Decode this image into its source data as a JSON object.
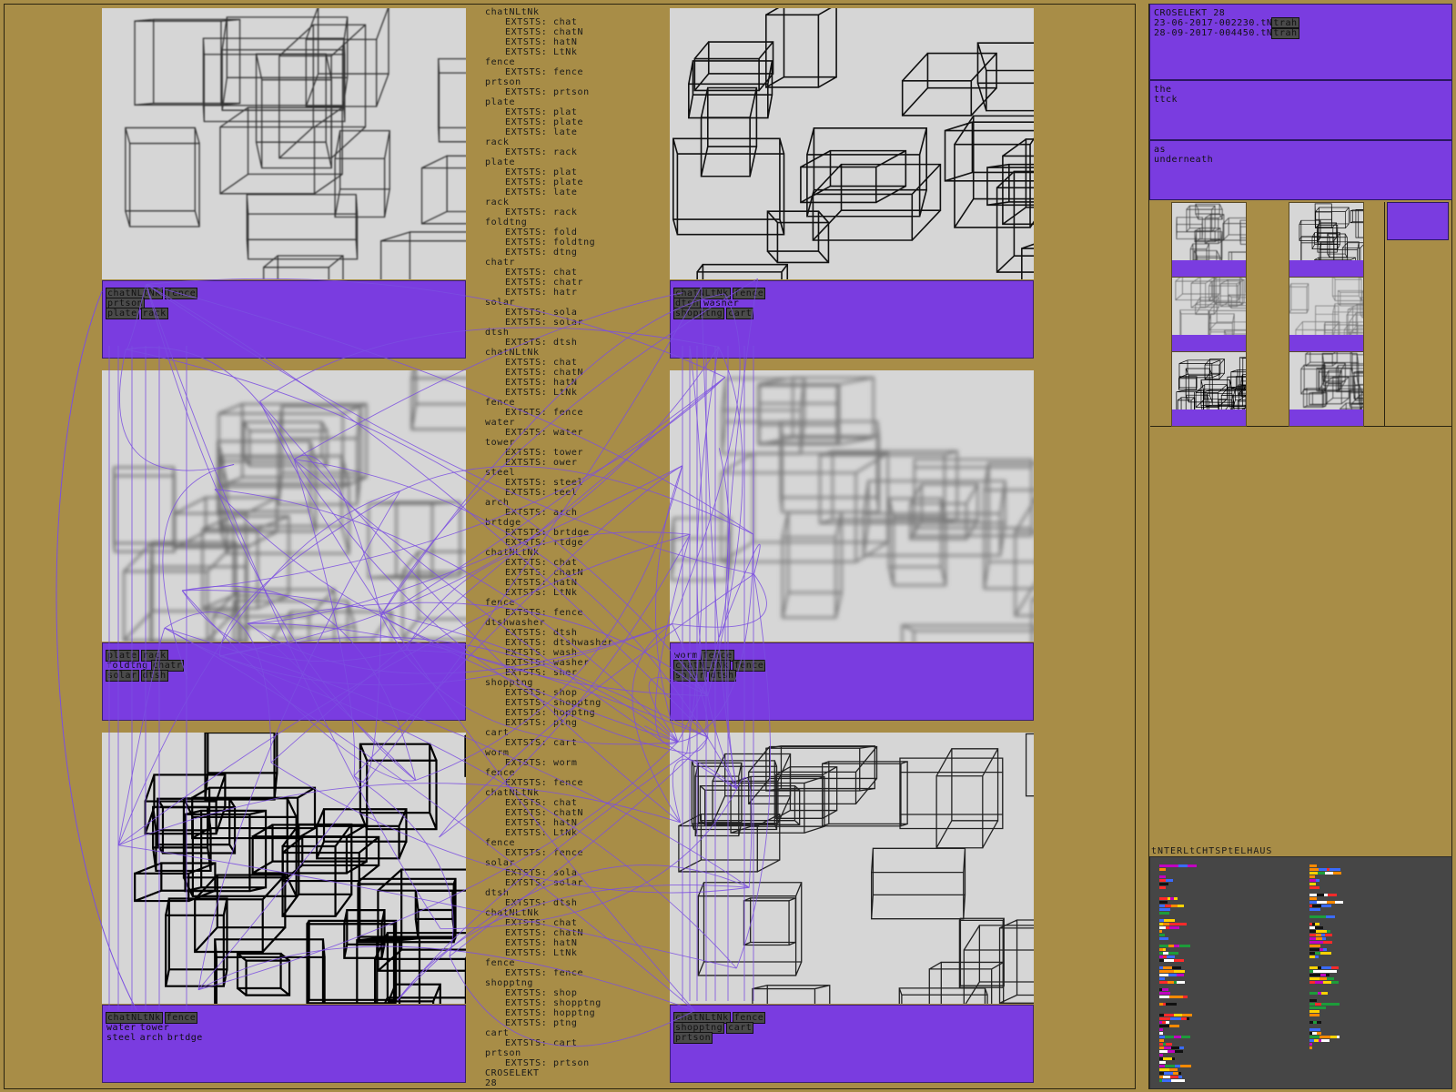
{
  "panels": [
    {
      "captions": [
        [
          {
            "t": "chatNLtNk",
            "tag": true
          },
          {
            "t": "fence",
            "tag": true
          }
        ],
        [
          {
            "t": "prtson",
            "tag": true
          }
        ],
        [
          {
            "t": "plate",
            "tag": true
          },
          {
            "t": "rack",
            "tag": true
          }
        ]
      ]
    },
    {
      "captions": [
        [
          {
            "t": "chatNLtNk",
            "tag": true
          },
          {
            "t": "fence",
            "tag": true
          }
        ],
        [
          {
            "t": "dtsh",
            "tag": true
          },
          {
            "t": "washer",
            "tag": false
          }
        ],
        [
          {
            "t": "shopptng",
            "tag": true
          },
          {
            "t": "cart",
            "tag": true
          }
        ]
      ]
    },
    {
      "captions": [
        [
          {
            "t": "plate",
            "tag": true
          },
          {
            "t": "rack",
            "tag": true
          }
        ],
        [
          {
            "t": "foldtng",
            "tag": false
          },
          {
            "t": "chatr",
            "tag": true
          }
        ],
        [
          {
            "t": "solar",
            "tag": true
          },
          {
            "t": "dtsh",
            "tag": true
          }
        ]
      ]
    },
    {
      "captions": [
        [
          {
            "t": "worm",
            "tag": false
          },
          {
            "t": "fence",
            "tag": true
          }
        ],
        [
          {
            "t": "chatNLtNk",
            "tag": true
          },
          {
            "t": "fence",
            "tag": true
          }
        ],
        [
          {
            "t": "solar",
            "tag": true
          },
          {
            "t": "dtsh",
            "tag": true
          }
        ]
      ]
    },
    {
      "captions": [
        [
          {
            "t": "chatNLtNk",
            "tag": true
          },
          {
            "t": "fence",
            "tag": true
          }
        ],
        [
          {
            "t": "water",
            "tag": false
          },
          {
            "t": "tower",
            "tag": false
          }
        ],
        [
          {
            "t": "steel",
            "tag": false
          },
          {
            "t": "arch",
            "tag": false
          },
          {
            "t": "brtdge",
            "tag": false
          }
        ]
      ]
    },
    {
      "captions": [
        [
          {
            "t": "chatNLtNk",
            "tag": true
          },
          {
            "t": "fence",
            "tag": true
          }
        ],
        [
          {
            "t": "shopptng",
            "tag": true
          },
          {
            "t": "cart",
            "tag": true
          }
        ],
        [
          {
            "t": "prtson",
            "tag": true
          }
        ]
      ]
    }
  ],
  "log": [
    {
      "w": "chatNLtNk",
      "e": [
        "EXTSTS: chat",
        "EXTSTS: chatN",
        "EXTSTS: hatN",
        "EXTSTS: LtNk"
      ]
    },
    {
      "w": "fence",
      "e": [
        "EXTSTS: fence"
      ]
    },
    {
      "w": "prtson",
      "e": [
        "EXTSTS: prtson"
      ]
    },
    {
      "w": "plate",
      "e": [
        "EXTSTS: plat",
        "EXTSTS: plate",
        "EXTSTS: late"
      ]
    },
    {
      "w": "rack",
      "e": [
        "EXTSTS: rack"
      ]
    },
    {
      "w": "plate",
      "e": [
        "EXTSTS: plat",
        "EXTSTS: plate",
        "EXTSTS: late"
      ]
    },
    {
      "w": "rack",
      "e": [
        "EXTSTS: rack"
      ]
    },
    {
      "w": "foldtng",
      "e": [
        "EXTSTS: fold",
        "EXTSTS: foldtng",
        "EXTSTS: dtng"
      ]
    },
    {
      "w": "chatr",
      "e": [
        "EXTSTS: chat",
        "EXTSTS: chatr",
        "EXTSTS: hatr"
      ]
    },
    {
      "w": "solar",
      "e": [
        "EXTSTS: sola",
        "EXTSTS: solar"
      ]
    },
    {
      "w": "dtsh",
      "e": [
        "EXTSTS: dtsh"
      ]
    },
    {
      "w": "chatNLtNk",
      "e": [
        "EXTSTS: chat",
        "EXTSTS: chatN",
        "EXTSTS: hatN",
        "EXTSTS: LtNk"
      ]
    },
    {
      "w": "fence",
      "e": [
        "EXTSTS: fence"
      ]
    },
    {
      "w": "water",
      "e": [
        "EXTSTS: water"
      ]
    },
    {
      "w": "tower",
      "e": [
        "EXTSTS: tower",
        "EXTSTS: ower"
      ]
    },
    {
      "w": "steel",
      "e": [
        "EXTSTS: steel",
        "EXTSTS: teel"
      ]
    },
    {
      "w": "arch",
      "e": [
        "EXTSTS: arch"
      ]
    },
    {
      "w": "brtdge",
      "e": [
        "EXTSTS: brtdge",
        "EXTSTS: rtdge"
      ]
    },
    {
      "w": "chatNLtNk",
      "e": [
        "EXTSTS: chat",
        "EXTSTS: chatN",
        "EXTSTS: hatN",
        "EXTSTS: LtNk"
      ]
    },
    {
      "w": "fence",
      "e": [
        "EXTSTS: fence"
      ]
    },
    {
      "w": "dtshwasher",
      "e": [
        "EXTSTS: dtsh",
        "EXTSTS: dtshwasher",
        "EXTSTS: wash",
        "EXTSTS: washer",
        "EXTSTS: sher"
      ]
    },
    {
      "w": "shopptng",
      "e": [
        "EXTSTS: shop",
        "EXTSTS: shopptng",
        "EXTSTS: hopptng",
        "EXTSTS: ptng"
      ]
    },
    {
      "w": "cart",
      "e": [
        "EXTSTS: cart"
      ]
    },
    {
      "w": "worm",
      "e": [
        "EXTSTS: worm"
      ]
    },
    {
      "w": "fence",
      "e": [
        "EXTSTS: fence"
      ]
    },
    {
      "w": "chatNLtNk",
      "e": [
        "EXTSTS: chat",
        "EXTSTS: chatN",
        "EXTSTS: hatN",
        "EXTSTS: LtNk"
      ]
    },
    {
      "w": "fence",
      "e": [
        "EXTSTS: fence"
      ]
    },
    {
      "w": "solar",
      "e": [
        "EXTSTS: sola",
        "EXTSTS: solar"
      ]
    },
    {
      "w": "dtsh",
      "e": [
        "EXTSTS: dtsh"
      ]
    },
    {
      "w": "chatNLtNk",
      "e": [
        "EXTSTS: chat",
        "EXTSTS: chatN",
        "EXTSTS: hatN",
        "EXTSTS: LtNk"
      ]
    },
    {
      "w": "fence",
      "e": [
        "EXTSTS: fence"
      ]
    },
    {
      "w": "shopptng",
      "e": [
        "EXTSTS: shop",
        "EXTSTS: shopptng",
        "EXTSTS: hopptng",
        "EXTSTS: ptng"
      ]
    },
    {
      "w": "cart",
      "e": [
        "EXTSTS: cart"
      ]
    },
    {
      "w": "prtson",
      "e": [
        "EXTSTS: prtson"
      ]
    },
    {
      "w": "CROSELEKT",
      "e": []
    },
    {
      "w": "28",
      "e": []
    }
  ],
  "side": {
    "title": "CROSELEKT 28",
    "files": [
      {
        "name": "23-06-2017-002230.tN",
        "hl": "trah"
      },
      {
        "name": "28-09-2017-004450.tN",
        "hl": "trah"
      }
    ],
    "note1": [
      "the",
      "ttck"
    ],
    "note2": [
      "as",
      "underneath"
    ],
    "haus_label": "tNTERLtCHTSPtELHAUS"
  },
  "colors": {
    "bg": "#A88D47",
    "accent": "#7A3CE0",
    "link": "#7B4FE0"
  }
}
